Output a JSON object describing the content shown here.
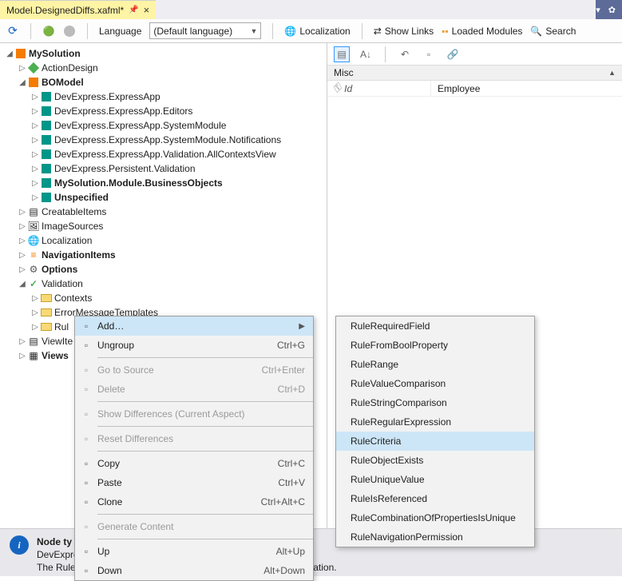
{
  "tab": {
    "title": "Model.DesignedDiffs.xafml*"
  },
  "toolbar": {
    "language_label": "Language",
    "language_value": "(Default language)",
    "localization": "Localization",
    "show_links": "Show Links",
    "loaded_modules": "Loaded Modules",
    "search": "Search"
  },
  "tree": {
    "root": "MySolution",
    "action_design": "ActionDesign",
    "bomodel": "BOModel",
    "bo_items": [
      "DevExpress.ExpressApp",
      "DevExpress.ExpressApp.Editors",
      "DevExpress.ExpressApp.SystemModule",
      "DevExpress.ExpressApp.SystemModule.Notifications",
      "DevExpress.ExpressApp.Validation.AllContextsView",
      "DevExpress.Persistent.Validation",
      "MySolution.Module.BusinessObjects",
      "Unspecified"
    ],
    "creatable_items": "CreatableItems",
    "image_sources": "ImageSources",
    "localization": "Localization",
    "navigation_items": "NavigationItems",
    "options": "Options",
    "validation": "Validation",
    "validation_children": [
      "Contexts",
      "ErrorMessageTemplates",
      "Rul"
    ],
    "view_ite": "ViewIte",
    "views": "Views"
  },
  "prop": {
    "section": "Misc",
    "col_id": "Id",
    "col_value": "Employee"
  },
  "ctx_main": [
    {
      "label": "Add…",
      "shortcut": "",
      "arrow": true,
      "hl": true
    },
    {
      "label": "Ungroup",
      "shortcut": "Ctrl+G"
    },
    {
      "sep": true
    },
    {
      "label": "Go to Source",
      "shortcut": "Ctrl+Enter",
      "disabled": true
    },
    {
      "label": "Delete",
      "shortcut": "Ctrl+D",
      "disabled": true
    },
    {
      "sep": true
    },
    {
      "label": "Show Differences (Current Aspect)",
      "disabled": true
    },
    {
      "sep": true
    },
    {
      "label": "Reset Differences",
      "disabled": true
    },
    {
      "sep": true
    },
    {
      "label": "Copy",
      "shortcut": "Ctrl+C"
    },
    {
      "label": "Paste",
      "shortcut": "Ctrl+V"
    },
    {
      "label": "Clone",
      "shortcut": "Ctrl+Alt+C"
    },
    {
      "sep": true
    },
    {
      "label": "Generate Content",
      "disabled": true
    },
    {
      "sep": true
    },
    {
      "label": "Up",
      "shortcut": "Alt+Up"
    },
    {
      "label": "Down",
      "shortcut": "Alt+Down"
    }
  ],
  "ctx_sub": [
    {
      "label": "RuleRequiredField"
    },
    {
      "label": "RuleFromBoolProperty"
    },
    {
      "label": "RuleRange"
    },
    {
      "label": "RuleValueComparison"
    },
    {
      "label": "RuleStringComparison"
    },
    {
      "label": "RuleRegularExpression"
    },
    {
      "label": "RuleCriteria",
      "hl": true
    },
    {
      "label": "RuleObjectExists"
    },
    {
      "label": "RuleUniqueValue"
    },
    {
      "label": "RuleIsReferenced"
    },
    {
      "label": "RuleCombinationOfPropertiesIsUnique"
    },
    {
      "label": "RuleNavigationPermission"
    }
  ],
  "footer": {
    "title": "Node ty",
    "line1": "DevExpress.ExpressApp.Validation.IModelValidation",
    "line2": "The Rules node defines all the Rules that are applied in an application."
  }
}
